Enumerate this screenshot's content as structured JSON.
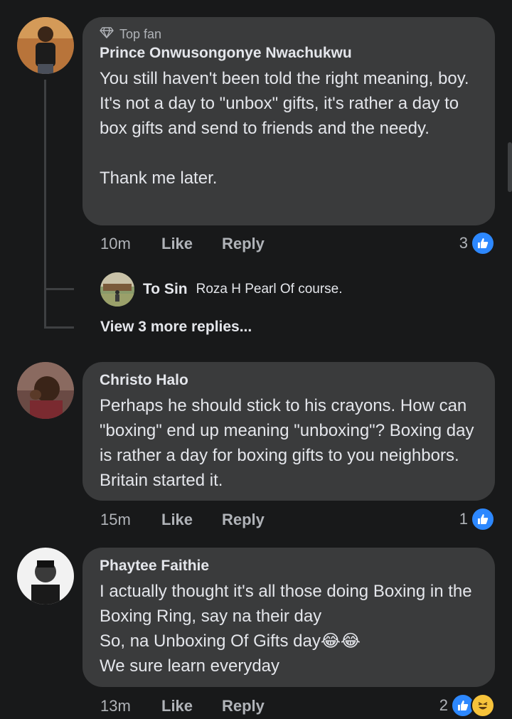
{
  "comments": [
    {
      "badge": "Top fan",
      "author": "Prince Onwusongonye Nwachukwu",
      "text": "You still haven't been told the right meaning, boy. It's not a day to \"unbox\" gifts, it's rather a day to box gifts and send to friends and the needy.\n\nThank me later.",
      "time": "10m",
      "like_label": "Like",
      "reply_label": "Reply",
      "reaction_count": "3",
      "reactions": [
        "like-icon"
      ]
    },
    {
      "author": "Christo Halo",
      "text": "Perhaps he should stick to his crayons. How can \"boxing\" end up meaning \"unboxing\"? Boxing day is rather a day for boxing gifts to you neighbors. Britain started it.",
      "time": "15m",
      "like_label": "Like",
      "reply_label": "Reply",
      "reaction_count": "1",
      "reactions": [
        "like-icon"
      ]
    },
    {
      "author": "Phaytee Faithie",
      "text": "I actually thought it's all those doing Boxing in the Boxing Ring, say na their day\nSo, na Unboxing Of Gifts day😂😂\nWe sure learn everyday",
      "time": "13m",
      "like_label": "Like",
      "reply_label": "Reply",
      "reaction_count": "2",
      "reactions": [
        "like-icon",
        "haha-icon"
      ]
    }
  ],
  "reply_preview": {
    "author": "To Sin",
    "text": "Roza H Pearl Of course."
  },
  "view_more": "View 3 more replies...",
  "colors": {
    "background": "#18191a",
    "bubble": "#3a3b3c",
    "like_blue": "#2d88ff",
    "text_primary": "#e4e6eb",
    "text_secondary": "#b0b3b8"
  }
}
